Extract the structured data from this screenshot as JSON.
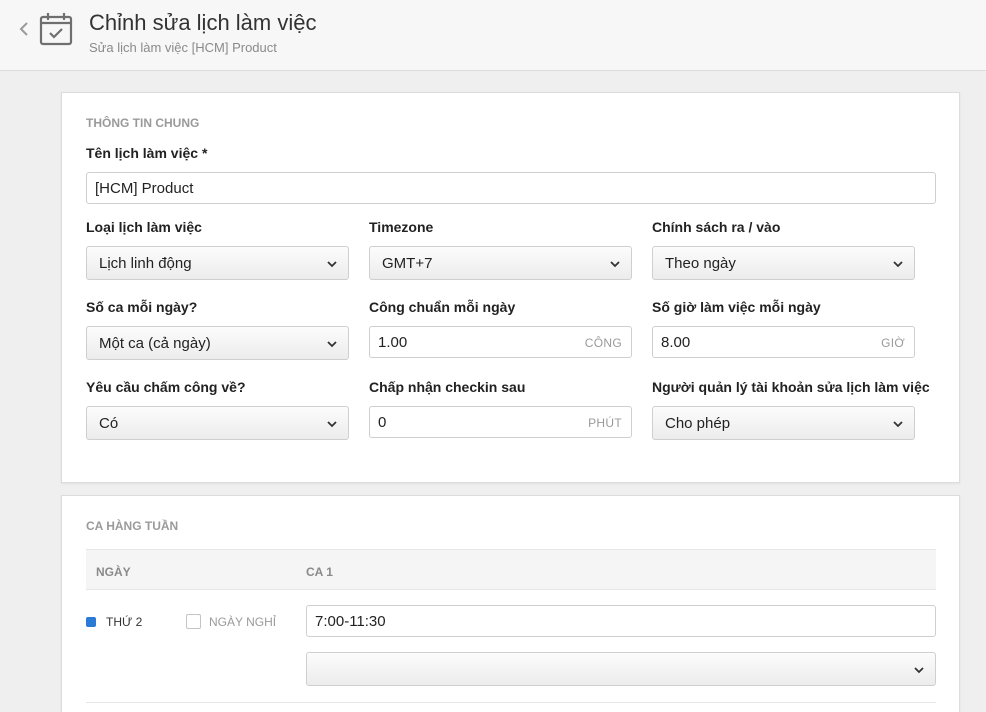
{
  "header": {
    "title": "Chỉnh sửa lịch làm việc",
    "subtitle": "Sửa lịch làm việc [HCM] Product"
  },
  "general": {
    "section_title": "THÔNG TIN CHUNG",
    "name_label": "Tên lịch làm việc *",
    "name_value": "[HCM] Product",
    "schedule_type": {
      "label": "Loại lịch làm việc",
      "value": "Lịch linh động"
    },
    "timezone": {
      "label": "Timezone",
      "value": "GMT+7"
    },
    "inout_policy": {
      "label": "Chính sách ra / vào",
      "value": "Theo ngày"
    },
    "shifts_per_day": {
      "label": "Số ca mỗi ngày?",
      "value": "Một ca (cả ngày)"
    },
    "standard_workdays": {
      "label": "Công chuẩn mỗi ngày",
      "value": "1.00",
      "unit": "CÔNG"
    },
    "hours_per_day": {
      "label": "Số giờ làm việc mỗi ngày",
      "value": "8.00",
      "unit": "GIỜ"
    },
    "checkout_required": {
      "label": "Yêu cầu chấm công về?",
      "value": "Có"
    },
    "late_checkin": {
      "label": "Chấp nhận checkin sau",
      "value": "0",
      "unit": "PHÚT"
    },
    "manager_edit": {
      "label": "Người quản lý tài khoản sửa lịch làm việc",
      "value": "Cho phép"
    }
  },
  "weekly": {
    "section_title": "CA HÀNG TUẦN",
    "columns": [
      "NGÀY",
      "CA 1"
    ],
    "rows": [
      {
        "day": "THỨ 2",
        "off_label": "NGÀY NGHỈ",
        "shift_value": "7:00-11:30",
        "shift_select_value": ""
      }
    ]
  },
  "colors": {
    "accent": "#2b7ad6",
    "background": "#efefef"
  }
}
